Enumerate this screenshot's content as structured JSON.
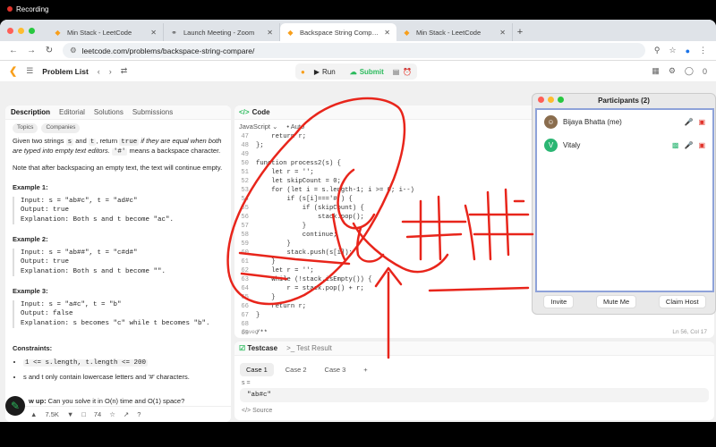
{
  "recording": {
    "label": "Recording"
  },
  "browser": {
    "tabs": [
      {
        "icon": "leetcode-icon",
        "title": "Min Stack - LeetCode",
        "active": false
      },
      {
        "icon": "globe-icon",
        "title": "Launch Meeting - Zoom",
        "active": false
      },
      {
        "icon": "leetcode-icon",
        "title": "Backspace String Compare -",
        "active": true
      },
      {
        "icon": "leetcode-icon",
        "title": "Min Stack - LeetCode",
        "active": false
      }
    ],
    "url": "leetcode.com/problems/backspace-string-compare/"
  },
  "lc_nav": {
    "problem_list": "Problem List",
    "run": "Run",
    "submit": "Submit",
    "coins": "0"
  },
  "left_panel": {
    "tabs": [
      "Description",
      "Editorial",
      "Solutions",
      "Submissions"
    ],
    "chips": [
      "Topics",
      "Companies"
    ],
    "statement": {
      "p1a": "Given two strings",
      "s": "s",
      "and": "and",
      "t": "t",
      "p1b": ", return",
      "true_code": "true",
      "p1c": "if they are equal when both are typed into empty text editors.",
      "hash": "'#'",
      "p1d": "means a backspace character.",
      "p2": "Note that after backspacing an empty text, the text will continue empty."
    },
    "examples": [
      {
        "title": "Example 1:",
        "input": "Input: s = \"ab#c\", t = \"ad#c\"",
        "output": "Output: true",
        "explanation": "Explanation: Both s and t become \"ac\"."
      },
      {
        "title": "Example 2:",
        "input": "Input: s = \"ab##\", t = \"c#d#\"",
        "output": "Output: true",
        "explanation": "Explanation: Both s and t become \"\"."
      },
      {
        "title": "Example 3:",
        "input": "Input: s = \"a#c\", t = \"b\"",
        "output": "Output: false",
        "explanation": "Explanation: s becomes \"c\" while t becomes \"b\"."
      }
    ],
    "constraints_title": "Constraints:",
    "constraints": [
      "1 <= s.length, t.length <= 200",
      "s and t only contain lowercase letters and '#' characters."
    ],
    "followup_label": "w up:",
    "followup_text": "Can you solve it in O(n) time and O(1) space?",
    "likes": "7.5K",
    "comments": "74"
  },
  "code_panel": {
    "title": "Code",
    "language": "JavaScript",
    "auto": "Auto",
    "lines": [
      {
        "n": "47",
        "t": "    return r;"
      },
      {
        "n": "48",
        "t": "};"
      },
      {
        "n": "49",
        "t": ""
      },
      {
        "n": "50",
        "t": "function process2(s) {"
      },
      {
        "n": "51",
        "t": "    let r = '';"
      },
      {
        "n": "52",
        "t": "    let skipCount = 0;"
      },
      {
        "n": "53",
        "t": "    for (let i = s.length-1; i >= 0; i--)"
      },
      {
        "n": "54",
        "t": "        if (s[i]==='#') {"
      },
      {
        "n": "55",
        "t": "            if (skipCount) {"
      },
      {
        "n": "56",
        "t": "                stack.pop();"
      },
      {
        "n": "57",
        "t": "            }"
      },
      {
        "n": "58",
        "t": "            continue;"
      },
      {
        "n": "59",
        "t": "        }"
      },
      {
        "n": "60",
        "t": "        stack.push(s[i]);"
      },
      {
        "n": "61",
        "t": "    }"
      },
      {
        "n": "62",
        "t": "    let r = '';"
      },
      {
        "n": "63",
        "t": "    while (!stack.isEmpty()) {"
      },
      {
        "n": "64",
        "t": "        r = stack.pop() + r;"
      },
      {
        "n": "65",
        "t": "    }"
      },
      {
        "n": "66",
        "t": "    return r;"
      },
      {
        "n": "67",
        "t": "}"
      },
      {
        "n": "68",
        "t": ""
      },
      {
        "n": "69",
        "t": "/**"
      }
    ],
    "saved": "Saved",
    "cursor": "Ln 56, Col 17"
  },
  "testcase": {
    "tab1": "Testcase",
    "tab2": "Test Result",
    "cases": [
      "Case 1",
      "Case 2",
      "Case 3"
    ],
    "var_label": "s =",
    "value": "\"ab#c\"",
    "source": "Source"
  },
  "zoom": {
    "title": "Participants (2)",
    "participants": [
      {
        "name": "Bijaya Bhatta (me)",
        "avatar": "photo",
        "color": "#8a6d4e"
      },
      {
        "name": "Vitaly",
        "avatar": "V",
        "color": "#2bb673"
      }
    ],
    "buttons": [
      "Invite",
      "Mute Me",
      "Claim Host"
    ]
  },
  "colors": {
    "annotation": "#e8251b",
    "accent": "#f89f1b",
    "submit": "#2cbb5d"
  }
}
